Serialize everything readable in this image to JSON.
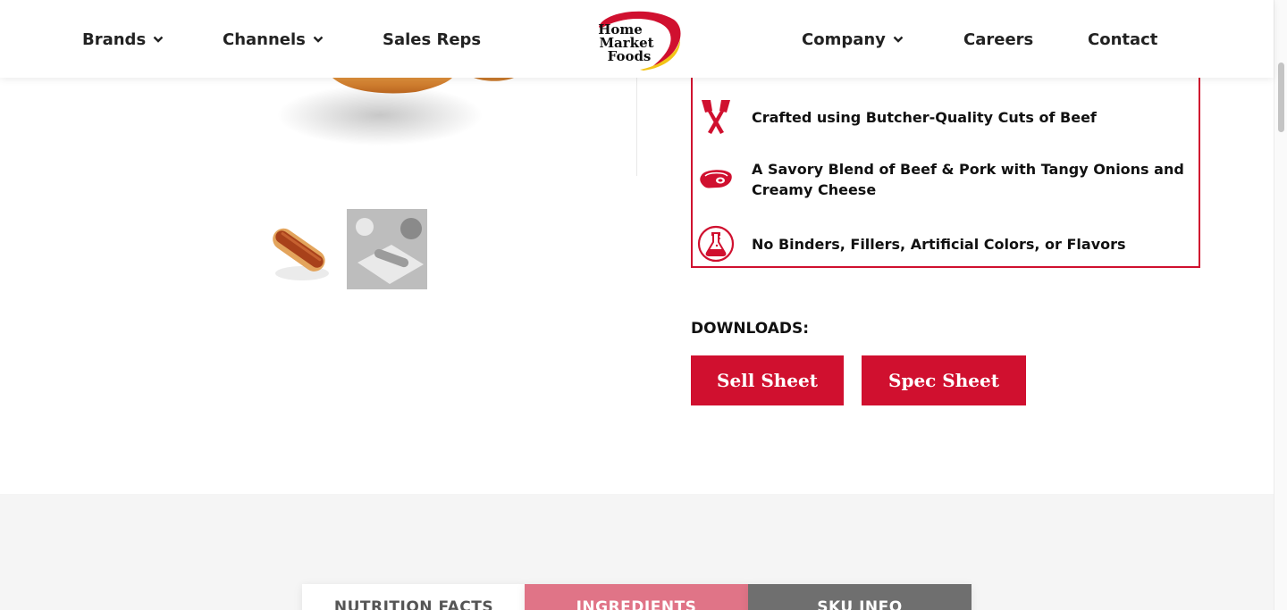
{
  "header": {
    "nav_left": [
      {
        "label": "Brands",
        "has_dropdown": true
      },
      {
        "label": "Channels",
        "has_dropdown": true
      },
      {
        "label": "Sales Reps",
        "has_dropdown": false
      }
    ],
    "logo": {
      "line1": "Home",
      "line2": "Market",
      "line3": "Foods"
    },
    "nav_right": [
      {
        "label": "Company",
        "has_dropdown": true
      },
      {
        "label": "Careers",
        "has_dropdown": false
      },
      {
        "label": "Contact",
        "has_dropdown": false
      }
    ]
  },
  "features": [
    {
      "icon": "cleaver-icon",
      "text": "Crafted using Butcher-Quality Cuts of Beef"
    },
    {
      "icon": "meat-icon",
      "text": "A Savory Blend of Beef & Pork with Tangy Onions and Creamy Cheese"
    },
    {
      "icon": "lab-flask-icon",
      "text": "No Binders, Fillers, Artificial Colors, or Flavors"
    }
  ],
  "downloads": {
    "label": "DOWNLOADS:",
    "sell_sheet": "Sell Sheet",
    "spec_sheet": "Spec Sheet"
  },
  "tabs": [
    {
      "label": "NUTRITION FACTS",
      "active": false
    },
    {
      "label": "INGREDIENTS",
      "active": true
    },
    {
      "label": "SKU INFO",
      "active": false
    }
  ],
  "colors": {
    "brand_red": "#d0102f",
    "tab_active": "#e07487",
    "tab_dark": "#6f6f6f",
    "logo_yellow": "#f2c418"
  }
}
